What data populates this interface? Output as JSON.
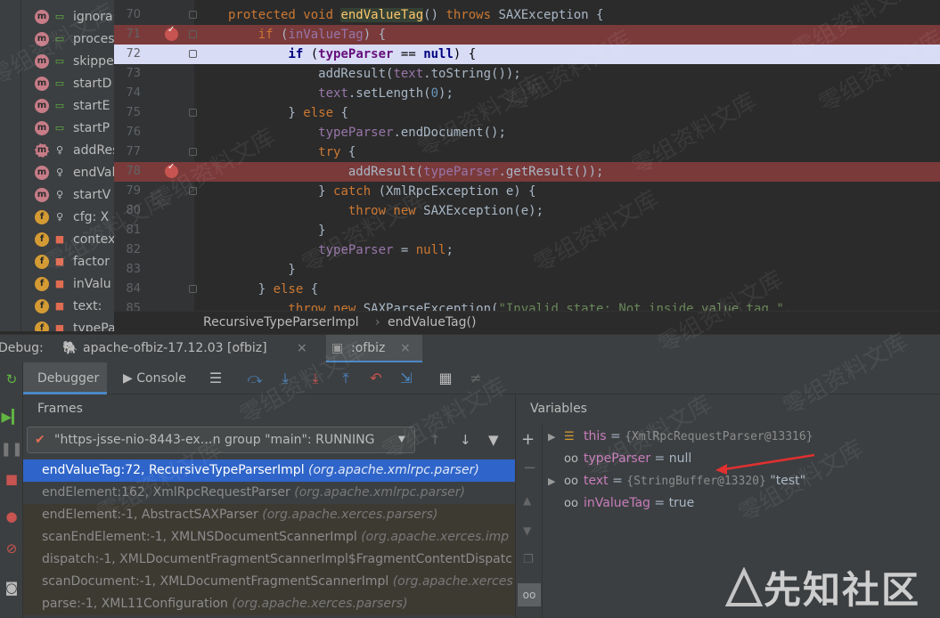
{
  "structure": {
    "items": [
      {
        "icon": "m",
        "mod": "pub",
        "label": "ignora"
      },
      {
        "icon": "m",
        "mod": "pub",
        "label": "proces"
      },
      {
        "icon": "m",
        "mod": "pub",
        "label": "skippe"
      },
      {
        "icon": "m",
        "mod": "pub",
        "label": "startD"
      },
      {
        "icon": "m",
        "mod": "pub",
        "label": "startE"
      },
      {
        "icon": "m",
        "mod": "pub",
        "label": "startP"
      },
      {
        "icon": "mx",
        "mod": "key",
        "label": "addRes"
      },
      {
        "icon": "m",
        "mod": "key",
        "label": "endVal"
      },
      {
        "icon": "m",
        "mod": "key",
        "label": "startV"
      },
      {
        "icon": "f",
        "mod": "key",
        "label": "cfg: X"
      },
      {
        "icon": "f",
        "mod": "lock",
        "label": "contex"
      },
      {
        "icon": "f",
        "mod": "lock",
        "label": "factor"
      },
      {
        "icon": "f",
        "mod": "lock",
        "label": "inValu"
      },
      {
        "icon": "f",
        "mod": "lock",
        "label": "text:"
      },
      {
        "icon": "f",
        "mod": "lock",
        "label": "typePa"
      }
    ]
  },
  "editor": {
    "lines": [
      {
        "num": "70",
        "kind": "normal",
        "html": "<span class=\"kw\">protected void </span><span class=\"fnh\">endValueTag</span>() <span class=\"kw\">throws </span>SAXException {"
      },
      {
        "num": "71",
        "kind": "bp",
        "html": "    <span class=\"kw\">if </span>(<span class=\"fld\">inValueTag</span>) {"
      },
      {
        "num": "72",
        "kind": "cur",
        "html": "        <span class=\"kw\">if </span>(<span class=\"fld\">typeParser </span>== <span class=\"kw\">null</span>) {"
      },
      {
        "num": "73",
        "kind": "normal",
        "html": "            addResult(<span class=\"fld\">text</span>.toString());"
      },
      {
        "num": "74",
        "kind": "normal",
        "html": "            <span class=\"fld\">text</span>.setLength(<span class=\"num\">0</span>);"
      },
      {
        "num": "75",
        "kind": "normal",
        "html": "        } <span class=\"kw\">else </span>{"
      },
      {
        "num": "76",
        "kind": "normal",
        "html": "            <span class=\"fld\">typeParser</span>.endDocument();"
      },
      {
        "num": "77",
        "kind": "normal",
        "html": "            <span class=\"kw\">try </span>{"
      },
      {
        "num": "78",
        "kind": "bp",
        "html": "                addResult(<span class=\"fld\">typeParser</span>.getResult());"
      },
      {
        "num": "79",
        "kind": "normal",
        "html": "            } <span class=\"kw\">catch </span>(XmlRpcException e) {"
      },
      {
        "num": "80",
        "kind": "normal",
        "html": "                <span class=\"kw\">throw new </span>SAXException(e);"
      },
      {
        "num": "81",
        "kind": "normal",
        "html": "            }"
      },
      {
        "num": "82",
        "kind": "normal",
        "html": "            <span class=\"fld\">typeParser </span>= <span class=\"kw\">null</span>;"
      },
      {
        "num": "83",
        "kind": "normal",
        "html": "        }"
      },
      {
        "num": "84",
        "kind": "normal",
        "html": "    } <span class=\"kw\">else </span>{"
      },
      {
        "num": "85",
        "kind": "normal",
        "html": "        <span class=\"kw\">throw new </span>SAXParseException(<span class=\"str\">\"Invalid state: Not inside value tag.\"</span>,"
      }
    ]
  },
  "breadcrumb": {
    "class_name": "RecursiveTypeParserImpl",
    "separator": "›",
    "method": "endValueTag()"
  },
  "debugbar": {
    "label": "Debug:",
    "config_tab": "apache-ofbiz-17.12.03 [ofbiz]",
    "active_tab": ":ofbiz",
    "close": "×"
  },
  "toolbar": {
    "debugger_tab": "Debugger",
    "console_tab": "Console"
  },
  "frames": {
    "header": "Frames",
    "thread": "\"https-jsse-nio-8443-ex…n group \"main\": RUNNING",
    "items": [
      {
        "method": "endValueTag:72, RecursiveTypeParserImpl",
        "pkg": "(org.apache.xmlrpc.parser)",
        "state": "sel"
      },
      {
        "method": "endElement:162, XmlRpcRequestParser",
        "pkg": "(org.apache.xmlrpc.parser)",
        "state": "normal"
      },
      {
        "method": "endElement:-1, AbstractSAXParser",
        "pkg": "(org.apache.xerces.parsers)",
        "state": "lib"
      },
      {
        "method": "scanEndElement:-1, XMLNSDocumentScannerImpl",
        "pkg": "(org.apache.xerces.imp",
        "state": "lib"
      },
      {
        "method": "dispatch:-1, XMLDocumentFragmentScannerImpl$FragmentContentDispatc",
        "pkg": "",
        "state": "lib"
      },
      {
        "method": "scanDocument:-1, XMLDocumentFragmentScannerImpl",
        "pkg": "(org.apache.xerces",
        "state": "lib"
      },
      {
        "method": "parse:-1, XML11Configuration",
        "pkg": "(org.apache.xerces.parsers)",
        "state": "lib"
      }
    ]
  },
  "variables": {
    "header": "Variables",
    "items": [
      {
        "expand": "▶",
        "kind": "field",
        "name": "this",
        "eq": " = ",
        "gray": "{XmlRpcRequestParser@13316}",
        "val": ""
      },
      {
        "expand": "",
        "kind": "watch",
        "name": "typeParser",
        "eq": " = ",
        "gray": "",
        "val": "null"
      },
      {
        "expand": "▶",
        "kind": "watch",
        "name": "text",
        "eq": " = ",
        "gray": "{StringBuffer@13320}",
        "val": " \"test\""
      },
      {
        "expand": "",
        "kind": "watch",
        "name": "inValueTag",
        "eq": " = ",
        "gray": "",
        "val": "true"
      }
    ]
  },
  "watermark": {
    "text": "零组资料文库",
    "logo": "先知社区"
  },
  "colors": {
    "breakpoint": "#7a3a3a",
    "current_line": "#d8dcf5",
    "selection": "#2f65ca",
    "arrow": "#e03030"
  }
}
